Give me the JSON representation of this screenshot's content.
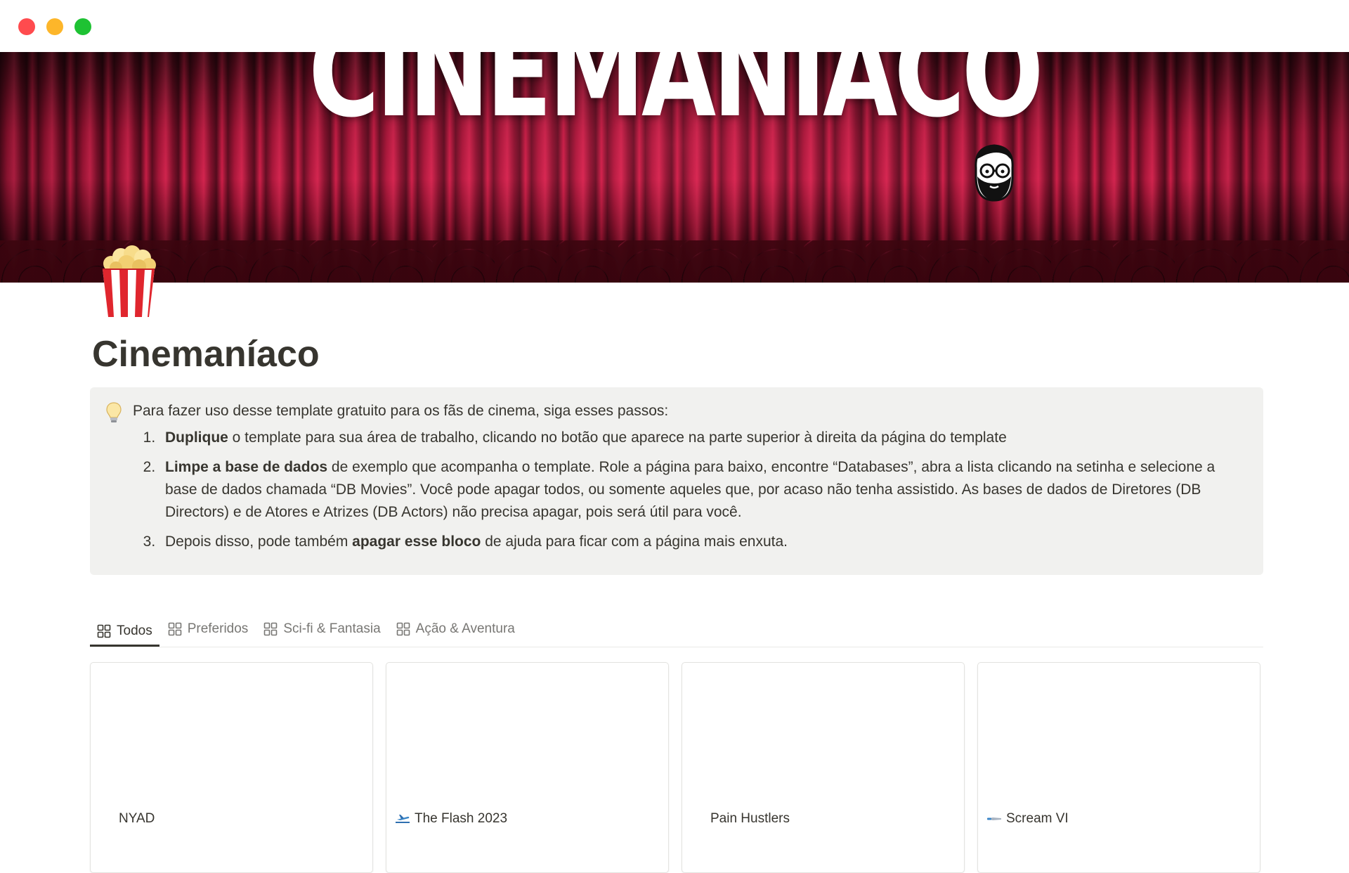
{
  "window": {
    "controls": [
      "close",
      "minimize",
      "zoom"
    ]
  },
  "cover": {
    "title": "CINEMANÍACO",
    "image": "red-theater-curtain",
    "sticker": "bearded-man-glasses"
  },
  "page": {
    "icon": "popcorn-icon",
    "title": "Cinemaníaco"
  },
  "callout": {
    "icon": "lightbulb-icon",
    "intro": "Para fazer uso desse template gratuito para os fãs de cinema, siga esses passos:",
    "steps": [
      {
        "bold": "Duplique",
        "rest": " o template para sua área de trabalho, clicando no botão que aparece na parte superior à direita da página do template"
      },
      {
        "bold": "Limpe a base de dados",
        "rest": " de exemplo que acompanha o template. Role a página para baixo, encontre “Databases”, abra a lista clicando na setinha e selecione a base de dados chamada “DB Movies”. Você pode apagar todos, ou somente aqueles que, por acaso não tenha assistido. As bases de dados de Diretores (DB Directors) e de Atores e Atrizes (DB Actors) não precisa apagar, pois será útil para você."
      },
      {
        "prefix": "Depois disso, pode também ",
        "bold": "apagar esse bloco",
        "rest": " de ajuda para ficar com a página mais enxuta."
      }
    ]
  },
  "views": {
    "tabs": [
      {
        "label": "Todos",
        "icon": "gallery-icon",
        "active": true
      },
      {
        "label": "Preferidos",
        "icon": "gallery-icon",
        "active": false
      },
      {
        "label": "Sci-fi & Fantasia",
        "icon": "gallery-icon",
        "active": false
      },
      {
        "label": "Ação & Aventura",
        "icon": "gallery-icon",
        "active": false
      }
    ]
  },
  "cards": [
    {
      "title": "NYAD",
      "icon": ""
    },
    {
      "title": "The Flash 2023",
      "icon": "plane-icon"
    },
    {
      "title": "Pain Hustlers",
      "icon": ""
    },
    {
      "title": "Scream VI",
      "icon": "knife-icon"
    }
  ],
  "colors": {
    "text": "#37352f",
    "muted": "#787774",
    "callout_bg": "#f1f1ef",
    "curtain": "#c81b45",
    "traffic_red": "#ff4b4e",
    "traffic_yellow": "#fdb62a",
    "traffic_green": "#1ec233"
  }
}
